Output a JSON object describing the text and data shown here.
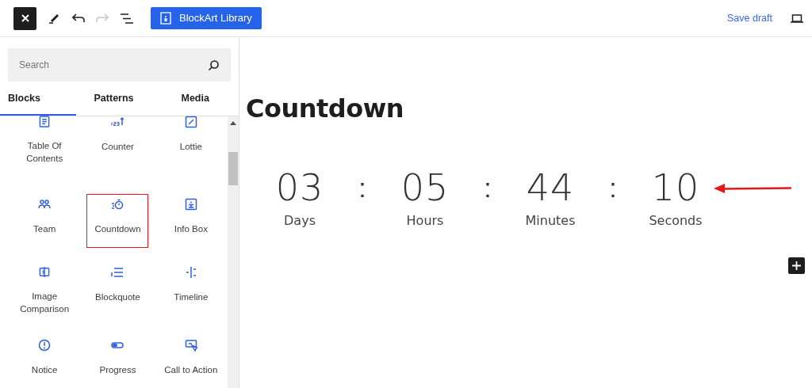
{
  "toolbar": {
    "library_button": "BlockArt Library",
    "save_draft": "Save draft",
    "redo_disabled": true
  },
  "inserter": {
    "search": {
      "placeholder": "Search"
    },
    "tabs": [
      {
        "label": "Blocks",
        "selected": true
      },
      {
        "label": "Patterns",
        "selected": false
      },
      {
        "label": "Media",
        "selected": false
      }
    ],
    "blocks": [
      {
        "label": "Table Of Contents",
        "selected": false
      },
      {
        "label": "Counter",
        "selected": false
      },
      {
        "label": "Lottie",
        "selected": false
      },
      {
        "label": "Team",
        "selected": false
      },
      {
        "label": "Countdown",
        "selected": true
      },
      {
        "label": "Info Box",
        "selected": false
      },
      {
        "label": "Image Comparison",
        "selected": false
      },
      {
        "label": "Blockquote",
        "selected": false
      },
      {
        "label": "Timeline",
        "selected": false
      },
      {
        "label": "Notice",
        "selected": false
      },
      {
        "label": "Progress",
        "selected": false
      },
      {
        "label": "Call to Action",
        "selected": false
      }
    ]
  },
  "canvas": {
    "heading": "Countdown",
    "countdown": [
      {
        "value": "03",
        "unit": "Days"
      },
      {
        "value": "05",
        "unit": "Hours"
      },
      {
        "value": "44",
        "unit": "Minutes"
      },
      {
        "value": "10",
        "unit": "Seconds"
      }
    ],
    "separator": ":"
  }
}
